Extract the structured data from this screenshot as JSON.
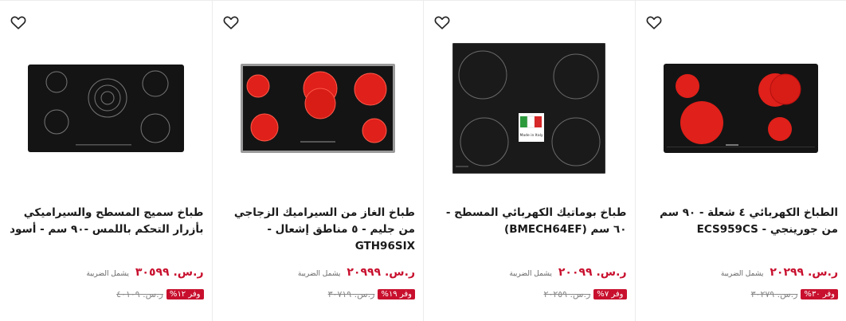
{
  "products": [
    {
      "title": "الطباخ الكهربائي ٤ شعلة - ٩٠ سم من جورينجي - ECS959CS",
      "price": "ر.س. ٢٠٢٩٩",
      "tax_note": "يشمل الضريبة",
      "old_price": "ر.س. ٣٠٢٧٩",
      "discount": "وفر ٣٠%",
      "icon": "heart-icon"
    },
    {
      "title": "طباخ بوماتيك الكهربائي المسطح - ٦٠ سم (BMECH64EF)",
      "price": "ر.س. ٢٠٠٩٩",
      "tax_note": "يشمل الضريبة",
      "old_price": "ر.س. ٢٠٢٥٩",
      "discount": "وفر ٧%",
      "icon": "heart-icon",
      "image_text": "Made in Italy"
    },
    {
      "title": "طباخ الغاز من السيراميك الزجاجي من جليم - ٥ مناطق إشعال - GTH96SIX",
      "price": "ر.س. ٢٠٩٩٩",
      "tax_note": "يشمل الضريبة",
      "old_price": "ر.س. ٣٠٧١٩",
      "discount": "وفر ١٩%",
      "icon": "heart-icon"
    },
    {
      "title": "طباخ سميج المسطح والسيراميكي بأزرار التحكم باللمس -٩٠ سم - أسود",
      "price": "ر.س. ٣٠٥٩٩",
      "tax_note": "يشمل الضريبة",
      "old_price": "ر.س. ٤٠١٠٩",
      "discount": "وفر ١٢%",
      "icon": "heart-icon"
    }
  ],
  "colors": {
    "accent": "#c8102e",
    "burner_red": "#e0201a"
  }
}
